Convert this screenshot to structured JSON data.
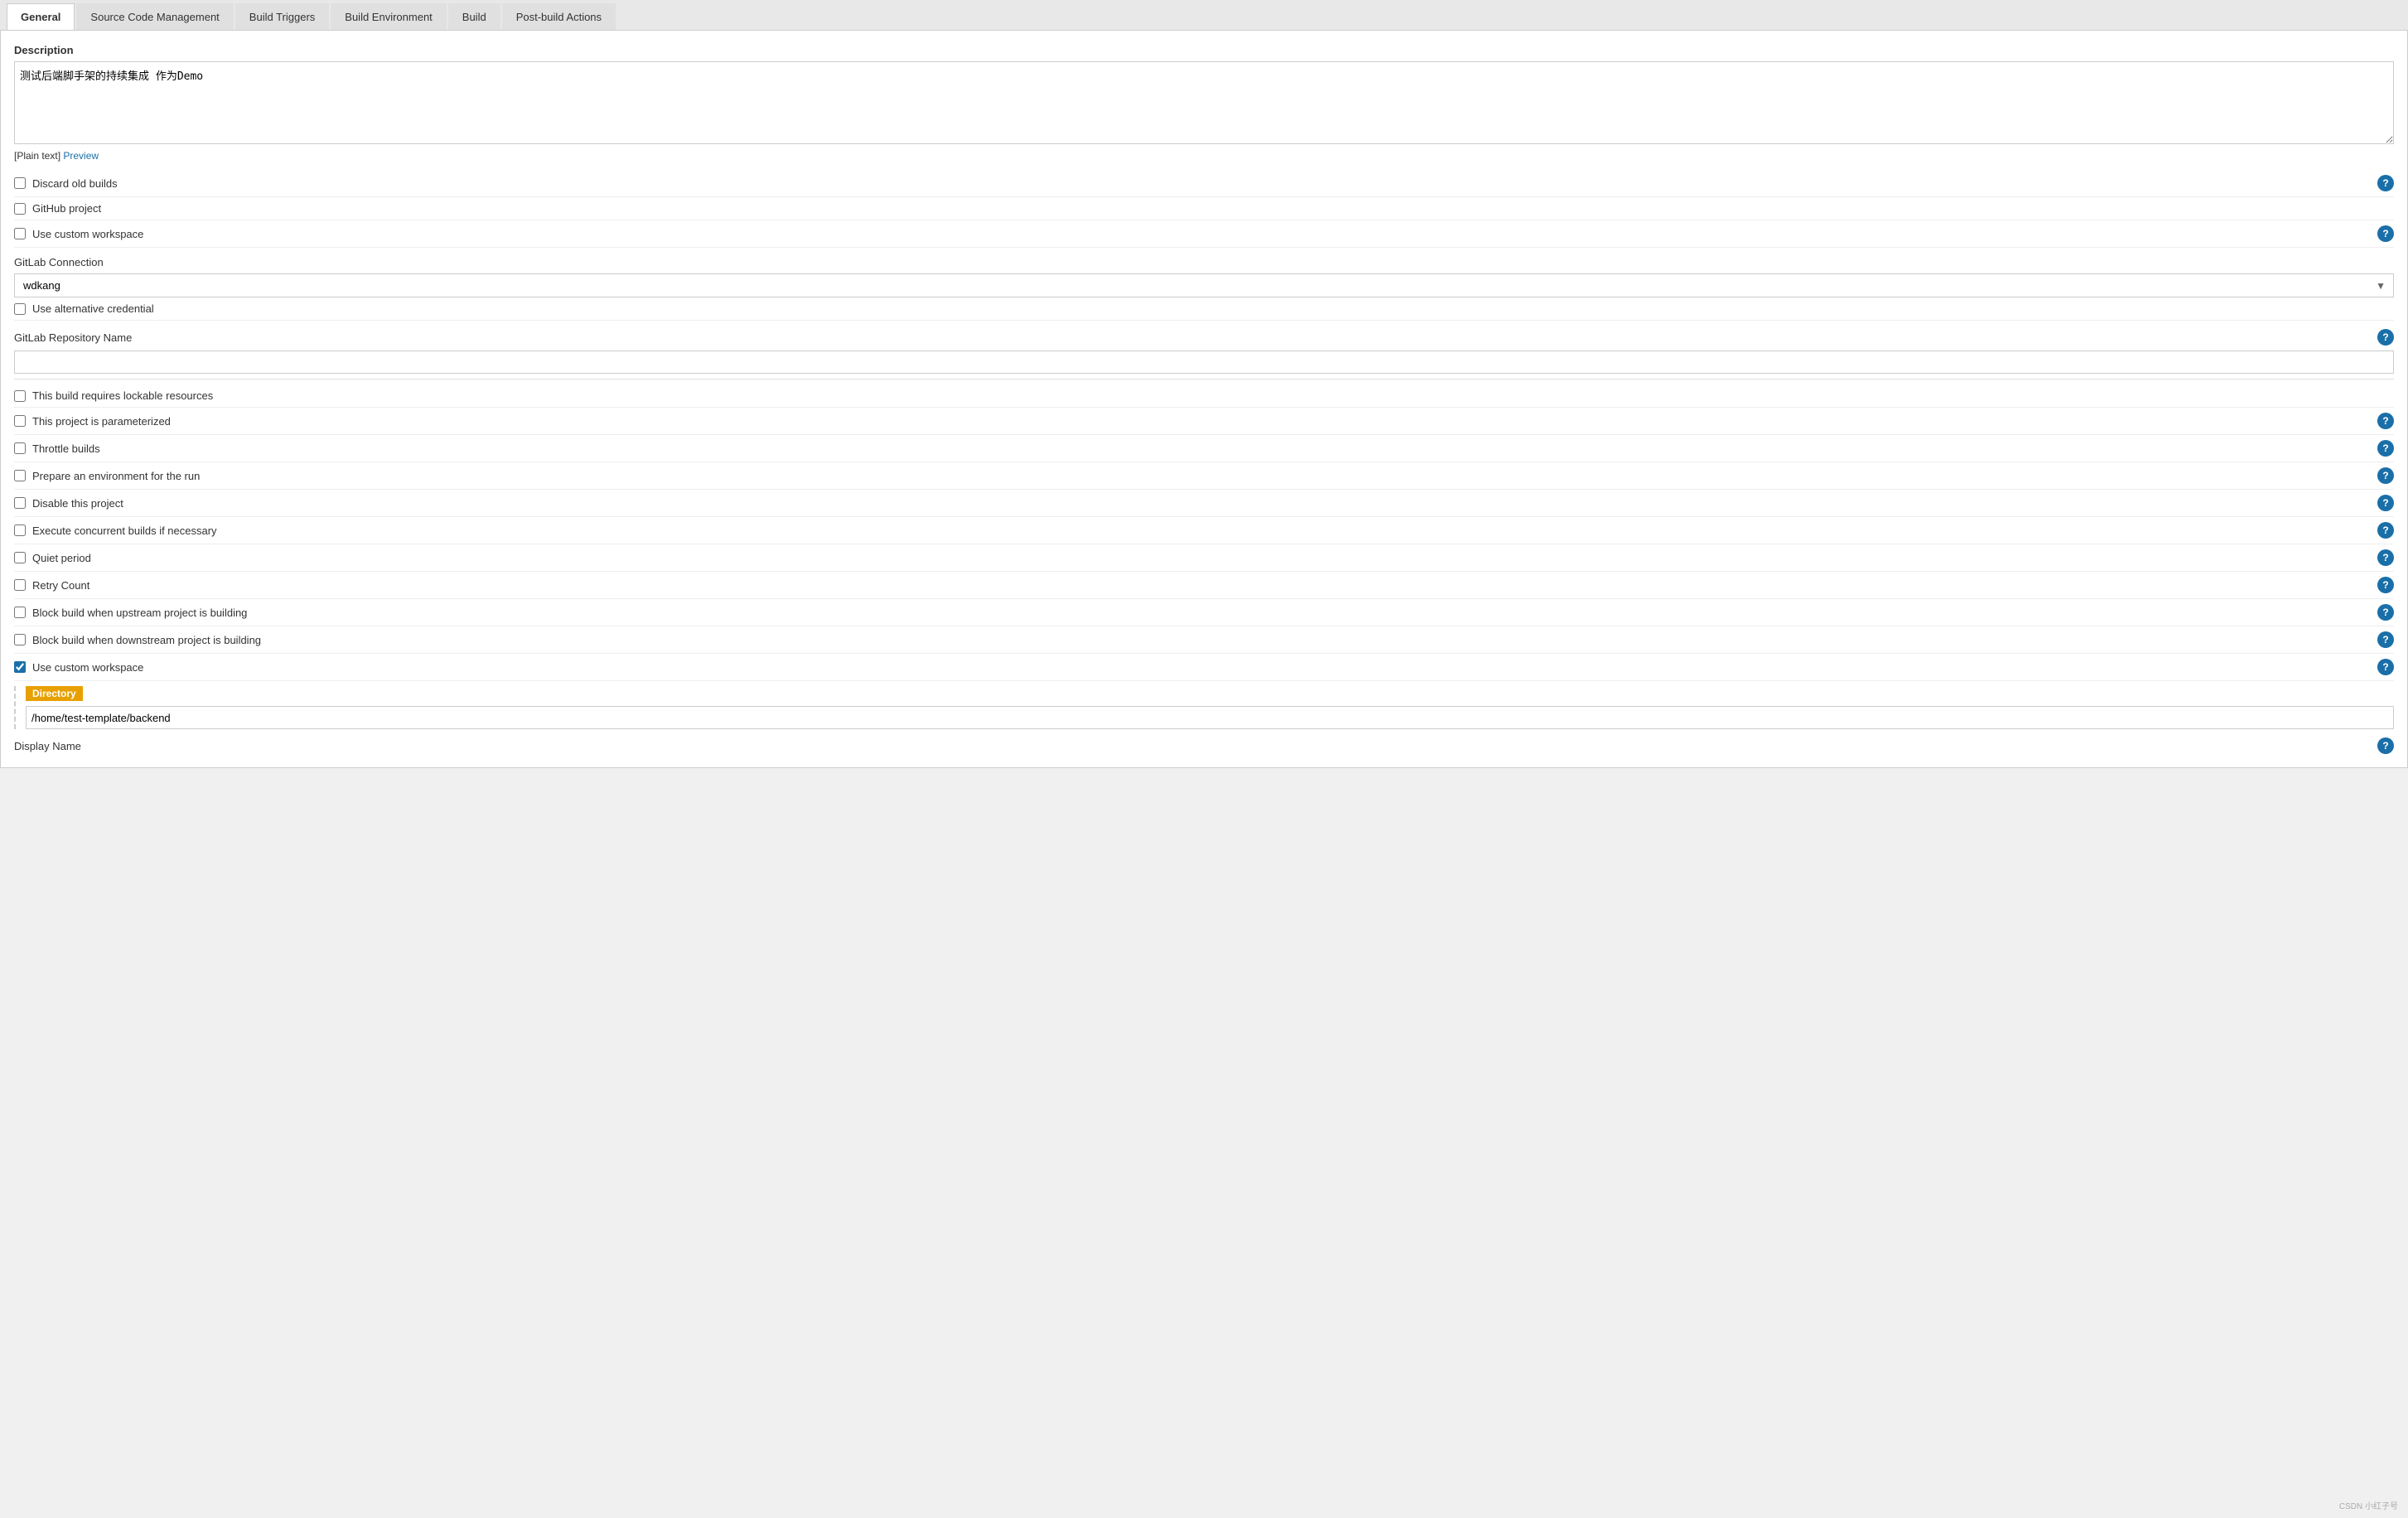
{
  "tabs": [
    {
      "id": "general",
      "label": "General",
      "active": true
    },
    {
      "id": "source-code",
      "label": "Source Code Management",
      "active": false
    },
    {
      "id": "build-triggers",
      "label": "Build Triggers",
      "active": false
    },
    {
      "id": "build-environment",
      "label": "Build Environment",
      "active": false
    },
    {
      "id": "build",
      "label": "Build",
      "active": false
    },
    {
      "id": "post-build",
      "label": "Post-build Actions",
      "active": false
    }
  ],
  "description": {
    "label": "Description",
    "value": "测试后端脚手架的持续集成 作为Demo",
    "plain_text_prefix": "[Plain text]",
    "preview_link": "Preview"
  },
  "checkboxes_top": [
    {
      "id": "discard-old-builds",
      "label": "Discard old builds",
      "checked": false,
      "has_help": true
    },
    {
      "id": "github-project",
      "label": "GitHub project",
      "checked": false,
      "has_help": false
    },
    {
      "id": "use-custom-workspace-top",
      "label": "Use custom workspace",
      "checked": false,
      "has_help": true
    }
  ],
  "gitlab_connection": {
    "label": "GitLab Connection",
    "value": "wdkang"
  },
  "use_alt_credential": {
    "label": "Use alternative credential",
    "checked": false
  },
  "gitlab_repo_name": {
    "label": "GitLab Repository Name",
    "value": "",
    "placeholder": ""
  },
  "checkboxes_bottom": [
    {
      "id": "lockable-resources",
      "label": "This build requires lockable resources",
      "checked": false,
      "has_help": false
    },
    {
      "id": "parameterized",
      "label": "This project is parameterized",
      "checked": false,
      "has_help": true
    },
    {
      "id": "throttle-builds",
      "label": "Throttle builds",
      "checked": false,
      "has_help": true
    },
    {
      "id": "prepare-env",
      "label": "Prepare an environment for the run",
      "checked": false,
      "has_help": true
    },
    {
      "id": "disable-project",
      "label": "Disable this project",
      "checked": false,
      "has_help": true
    },
    {
      "id": "concurrent-builds",
      "label": "Execute concurrent builds if necessary",
      "checked": false,
      "has_help": true
    },
    {
      "id": "quiet-period",
      "label": "Quiet period",
      "checked": false,
      "has_help": true
    },
    {
      "id": "retry-count",
      "label": "Retry Count",
      "checked": false,
      "has_help": true
    },
    {
      "id": "block-upstream",
      "label": "Block build when upstream project is building",
      "checked": false,
      "has_help": true
    },
    {
      "id": "block-downstream",
      "label": "Block build when downstream project is building",
      "checked": false,
      "has_help": true
    },
    {
      "id": "use-custom-workspace-bottom",
      "label": "Use custom workspace",
      "checked": true,
      "has_help": true
    }
  ],
  "directory": {
    "label": "Directory",
    "value": "/home/test-template/backend"
  },
  "display_name": {
    "label": "Display Name",
    "has_help": true
  },
  "watermark": "CSDN 小红子号"
}
